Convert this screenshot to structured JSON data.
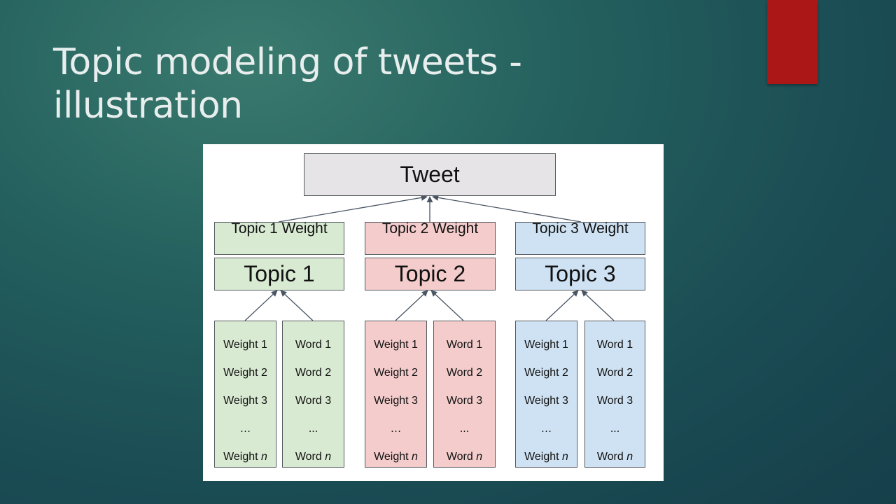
{
  "slide": {
    "title": "Topic modeling of tweets - illustration",
    "accent_color": "#ab1616"
  },
  "diagram": {
    "root_label": "Tweet",
    "topics": [
      {
        "color": "#d9ead3",
        "weight_label": "Topic 1 Weight",
        "label": "Topic 1",
        "weight_items": [
          "Weight 1",
          "Weight 2",
          "Weight 3",
          "…",
          "Weight"
        ],
        "word_items": [
          "Word 1",
          "Word 2",
          "Word 3",
          "...",
          "Word"
        ]
      },
      {
        "color": "#f4cccc",
        "weight_label": "Topic 2 Weight",
        "label": "Topic 2",
        "weight_items": [
          "Weight 1",
          "Weight 2",
          "Weight 3",
          "…",
          "Weight"
        ],
        "word_items": [
          "Word 1",
          "Word 2",
          "Word 3",
          "...",
          "Word"
        ]
      },
      {
        "color": "#cfe2f3",
        "weight_label": "Topic 3 Weight",
        "label": "Topic 3",
        "weight_items": [
          "Weight 1",
          "Weight 2",
          "Weight 3",
          "…",
          "Weight"
        ],
        "word_items": [
          "Word 1",
          "Word 2",
          "Word 3",
          "...",
          "Word"
        ]
      }
    ],
    "last_item_suffix": "n"
  }
}
